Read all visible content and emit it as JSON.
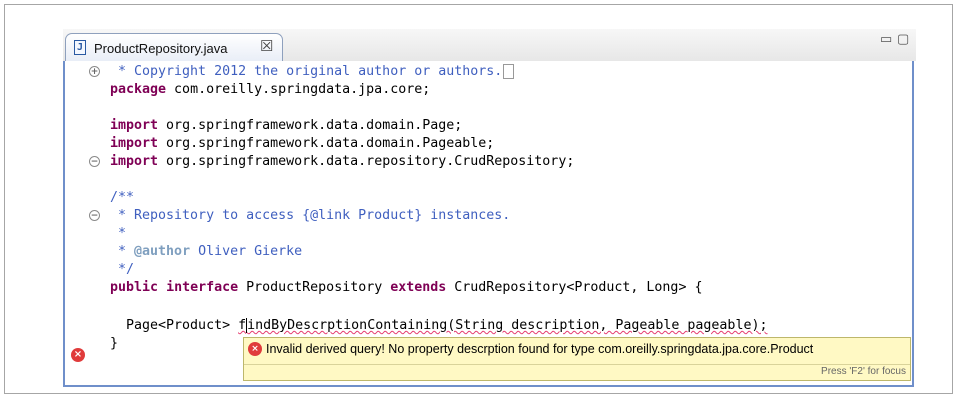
{
  "tab": {
    "label": "ProductRepository.java",
    "close": "☒"
  },
  "window_controls": {
    "minimize": "▭",
    "maximize": "▢"
  },
  "code": {
    "l1": " * Copyright 2012 the original author or authors.",
    "l2_kw": "package",
    "l2_rest": " com.oreilly.springdata.jpa.core;",
    "l4_kw": "import",
    "l4_rest": " org.springframework.data.domain.Page;",
    "l5_kw": "import",
    "l5_rest": " org.springframework.data.domain.Pageable;",
    "l6_kw": "import",
    "l6_rest": " org.springframework.data.repository.CrudRepository;",
    "l8": "/**",
    "l9": " * Repository to access {@link Product} instances.",
    "l10": " *",
    "l11_pre": " * ",
    "l11_tag": "@author",
    "l11_rest": " Oliver Gierke",
    "l12": " */",
    "l13_kw1": "public",
    "l13_kw2": "interface",
    "l13_name": " ProductRepository ",
    "l13_kw3": "extends",
    "l13_rest": " CrudRepository<Product, Long> {",
    "l15_pre": "  Page<Product> ",
    "l15_f": "f",
    "l15_err": "indByDescrptionContaining(String description, Pageable pageable);",
    "l16": "}"
  },
  "tooltip": {
    "message": "Invalid derived query! No property descrption found for type com.oreilly.springdata.jpa.core.Product",
    "hint": "Press 'F2' for focus"
  }
}
